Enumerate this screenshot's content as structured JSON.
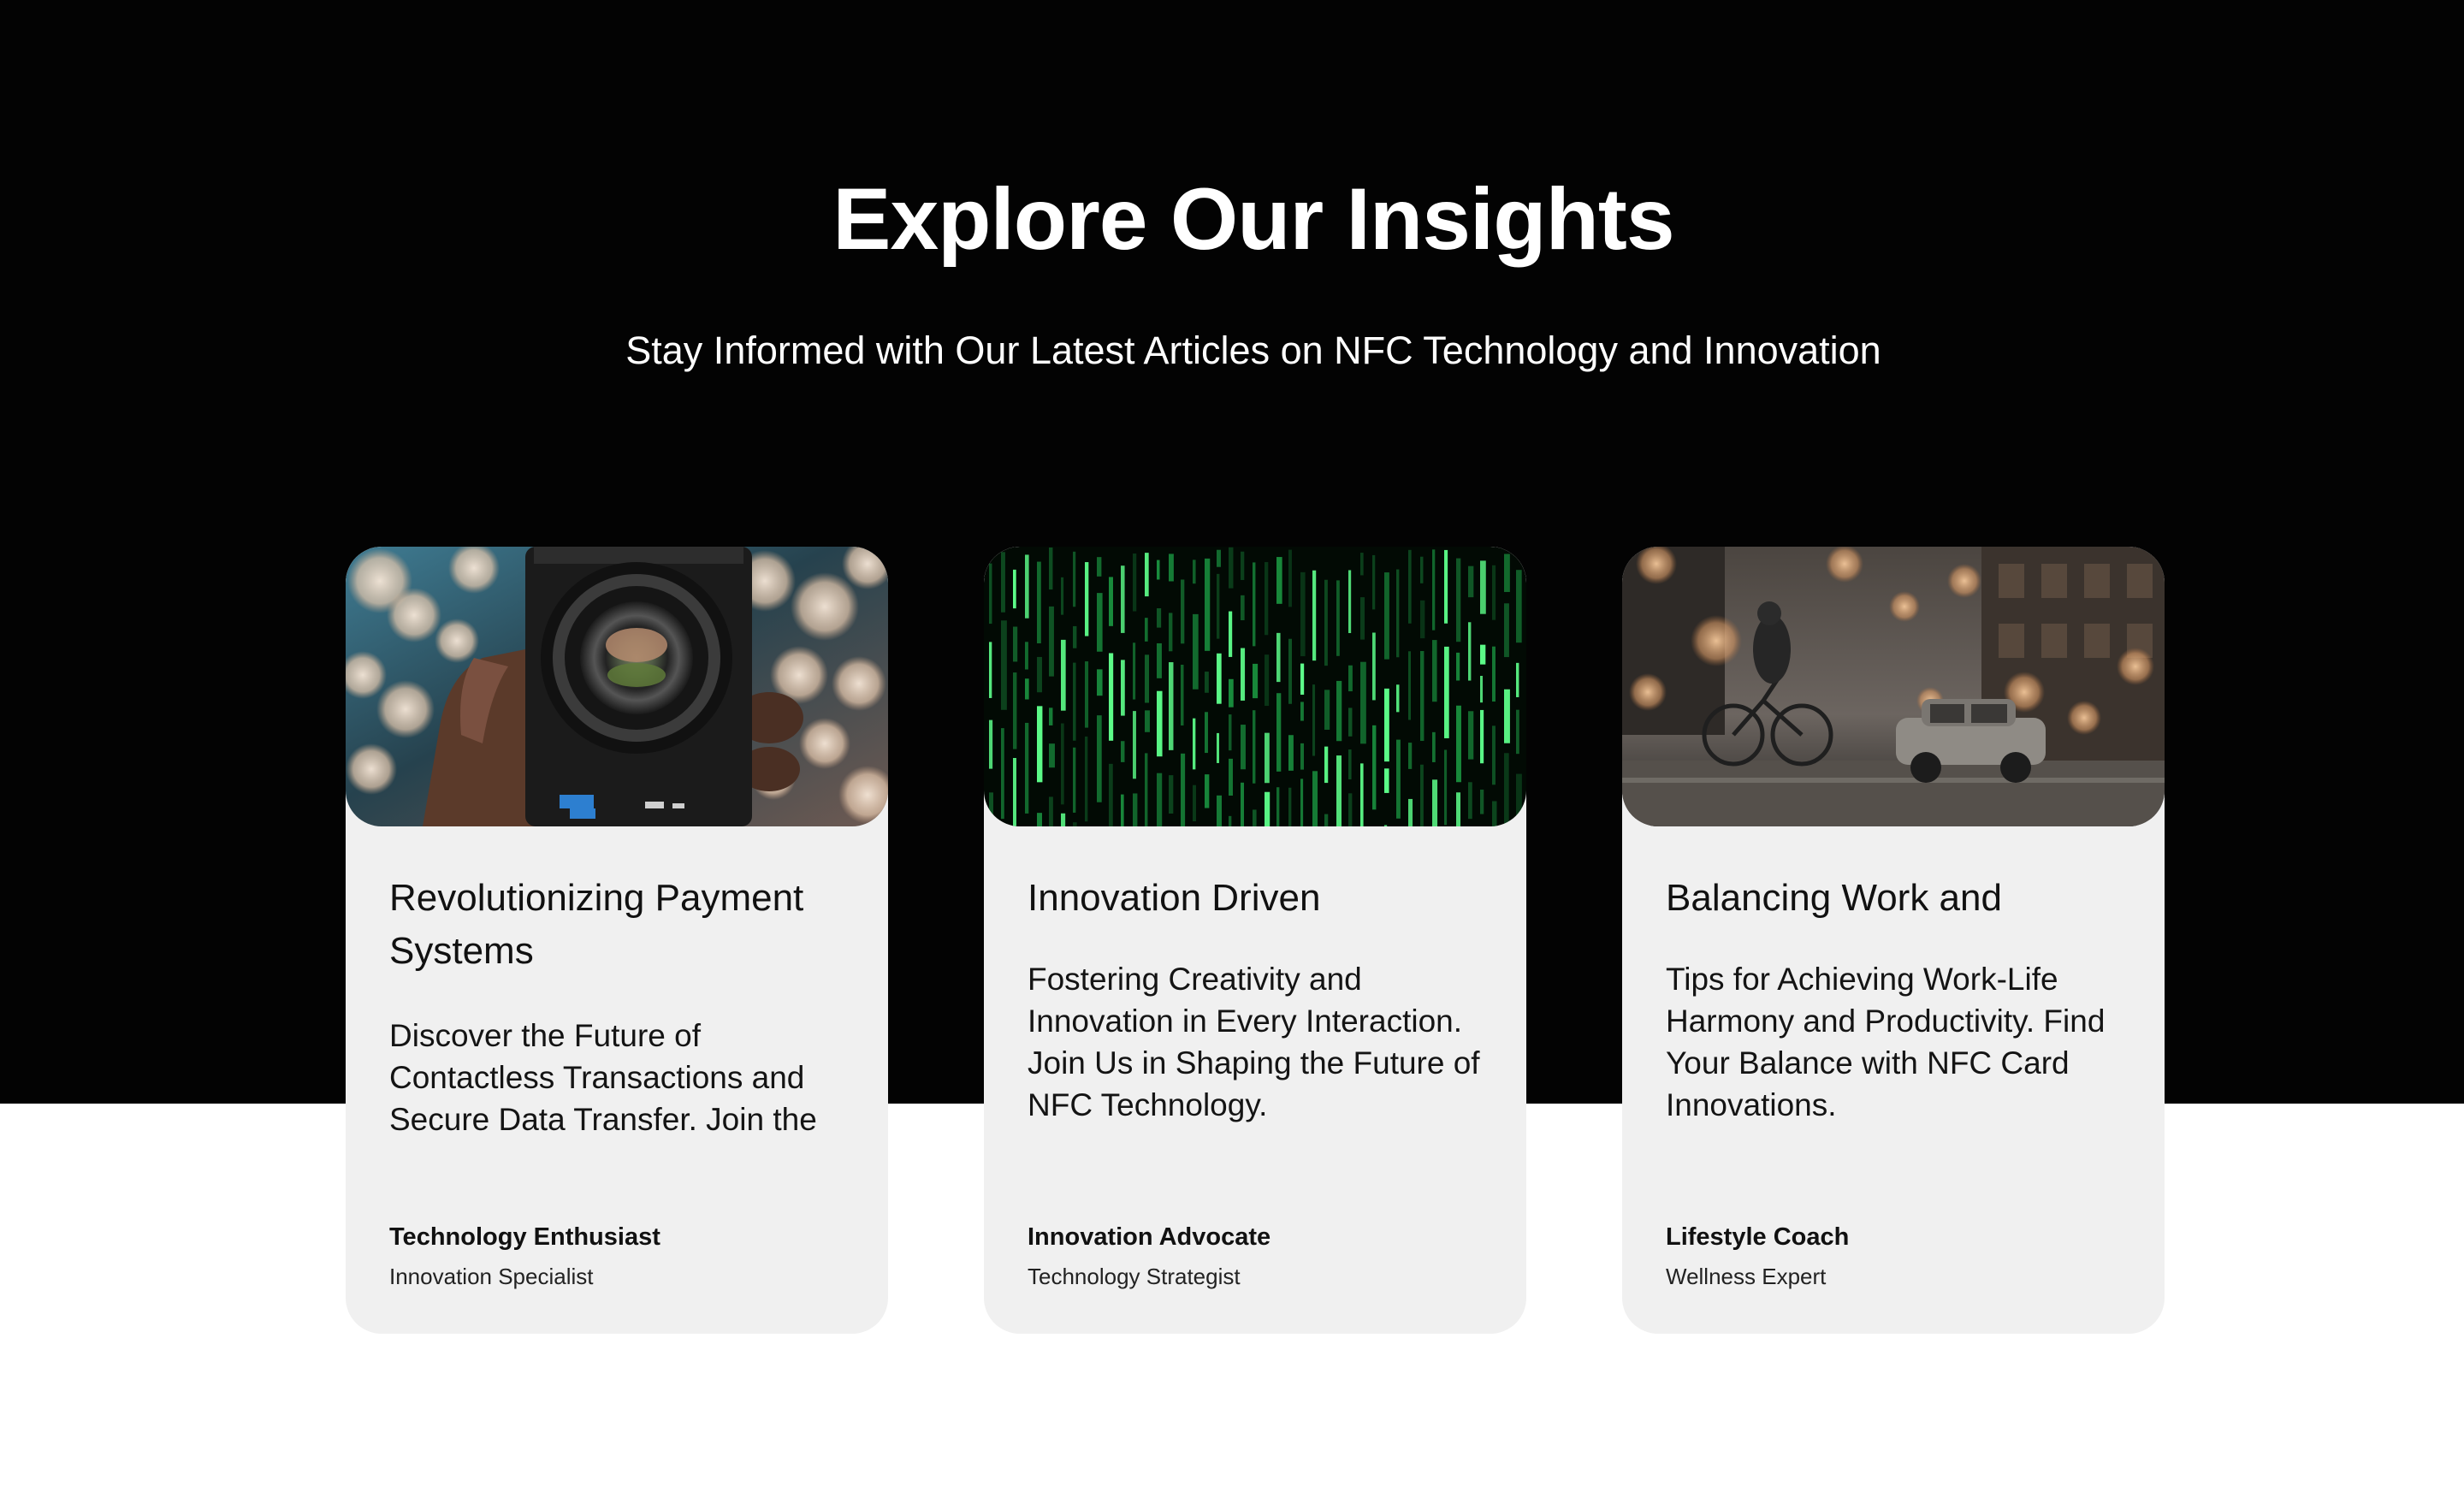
{
  "section": {
    "title": "Explore Our Insights",
    "subtitle": "Stay Informed with Our Latest Articles on NFC Technology and Innovation"
  },
  "cards": [
    {
      "image_alt": "camera-lens-photo",
      "title": "Revolutionizing Payment Systems",
      "description": "Discover the Future of Contactless Transactions and Secure Data Transfer. Join the NFC Revolution Today.",
      "author": "Technology Enthusiast",
      "role": "Innovation Specialist"
    },
    {
      "image_alt": "green-code-matrix-photo",
      "title": "Innovation Driven",
      "description": "Fostering Creativity and Innovation in Every Interaction. Join Us in Shaping the Future of NFC Technology.",
      "author": "Innovation Advocate",
      "role": "Technology Strategist"
    },
    {
      "image_alt": "city-street-bicycle-photo",
      "title": "Balancing Work and",
      "description": "Tips for Achieving Work-Life Harmony and Productivity. Find Your Balance with NFC Card Innovations.",
      "author": "Lifestyle Coach",
      "role": "Wellness Expert"
    }
  ],
  "colors": {
    "hero_background": "#030303",
    "card_background": "#f0f0f0",
    "text_dark": "#111111",
    "text_light": "#ffffff"
  }
}
